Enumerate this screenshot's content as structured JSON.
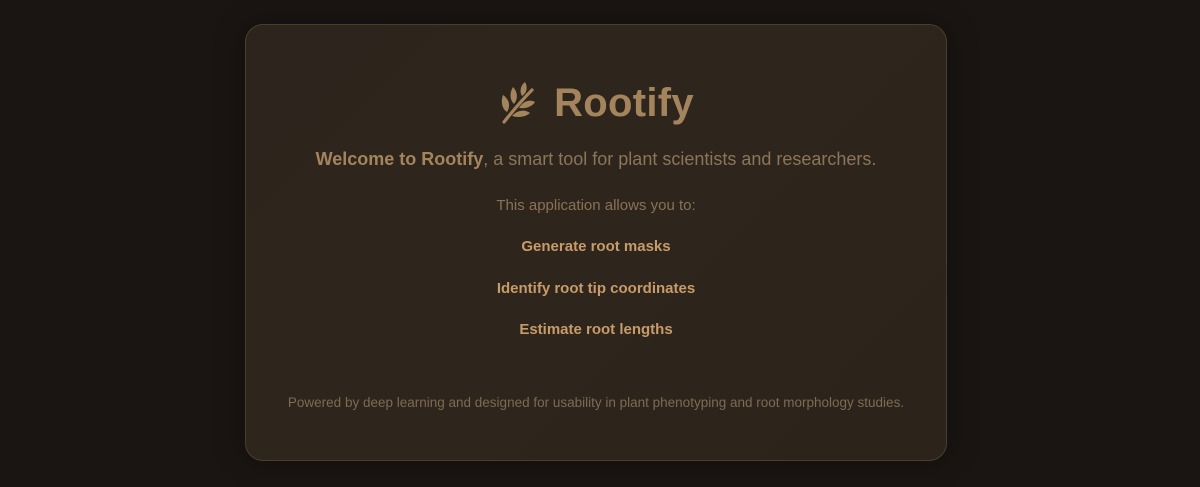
{
  "app": {
    "title": "Rootify",
    "icon": "plant-sprig-icon",
    "accent_color": "#a4845c",
    "feature_color": "#c79b6a",
    "background_color": "#1a1512",
    "card_color": "#2d251d"
  },
  "welcome": {
    "strong": "Welcome to Rootify",
    "rest": ", a smart tool for plant scientists and researchers."
  },
  "intro": "This application allows you to:",
  "features": [
    "Generate root masks",
    "Identify root tip coordinates",
    "Estimate root lengths"
  ],
  "footer": "Powered by deep learning and designed for usability in plant phenotyping and root morphology studies."
}
